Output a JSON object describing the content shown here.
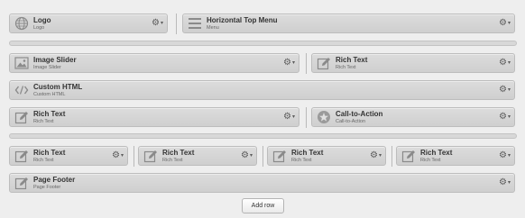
{
  "rows": {
    "r1": {
      "logo": {
        "title": "Logo",
        "subtitle": "Logo",
        "icon": "globe-icon"
      },
      "menu": {
        "title": "Horizontal Top Menu",
        "subtitle": "Menu",
        "icon": "menu-lines-icon"
      }
    },
    "r2": {
      "slider": {
        "title": "Image Slider",
        "subtitle": "Image Slider",
        "icon": "image-icon"
      },
      "rich": {
        "title": "Rich Text",
        "subtitle": "Rich Text",
        "icon": "pencil-edit-icon"
      }
    },
    "r3": {
      "html": {
        "title": "Custom HTML",
        "subtitle": "Custom HTML",
        "icon": "code-icon"
      }
    },
    "r4": {
      "rich": {
        "title": "Rich Text",
        "subtitle": "Rich Text",
        "icon": "pencil-edit-icon"
      },
      "cta": {
        "title": "Call-to-Action",
        "subtitle": "Call-to-Action",
        "icon": "star-icon"
      }
    },
    "r5": {
      "rich1": {
        "title": "Rich Text",
        "subtitle": "Rich Text",
        "icon": "pencil-edit-icon"
      },
      "rich2": {
        "title": "Rich Text",
        "subtitle": "Rich Text",
        "icon": "pencil-edit-icon"
      },
      "rich3": {
        "title": "Rich Text",
        "subtitle": "Rich Text",
        "icon": "pencil-edit-icon"
      },
      "rich4": {
        "title": "Rich Text",
        "subtitle": "Rich Text",
        "icon": "pencil-edit-icon"
      }
    },
    "r6": {
      "footer": {
        "title": "Page Footer",
        "subtitle": "Page Footer",
        "icon": "pencil-edit-icon"
      }
    }
  },
  "actions": {
    "add_row_label": "Add row"
  }
}
